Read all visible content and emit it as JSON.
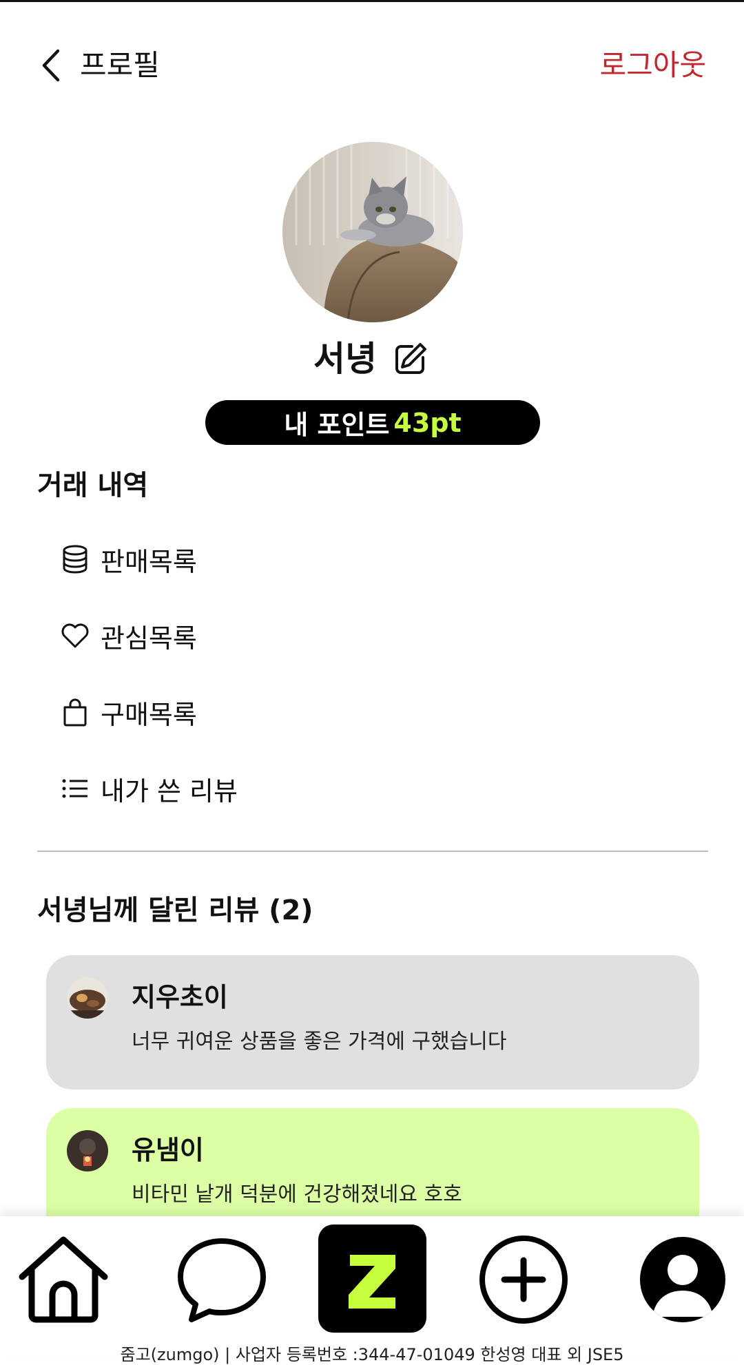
{
  "header": {
    "title": "프로필",
    "logout_label": "로그아웃"
  },
  "profile": {
    "name": "서녕",
    "points_label": "내 포인트",
    "points_value": "43pt"
  },
  "trade_history": {
    "title": "거래 내역",
    "items": [
      {
        "label": "판매목록",
        "icon": "coins-stack-icon"
      },
      {
        "label": "관심목록",
        "icon": "heart-icon"
      },
      {
        "label": "구매목록",
        "icon": "shopping-bag-icon"
      },
      {
        "label": "내가 쓴 리뷰",
        "icon": "list-icon"
      }
    ]
  },
  "reviews": {
    "title": "서녕님께 달린 리뷰 (2)",
    "items": [
      {
        "name": "지우초이",
        "text": "너무 귀여운 상품을 좋은 가격에 구했습니다",
        "bg": "#e0e0e0"
      },
      {
        "name": "유냄이",
        "text": "비타민 낱개 덕분에 건강해졌네요 호호",
        "bg": "#dcffa6"
      }
    ]
  },
  "bottom_nav": {
    "items": [
      "home-icon",
      "chat-bubble-icon",
      "zumgo-logo",
      "add-circle-icon",
      "profile-icon"
    ],
    "logo_letter": "Z",
    "logo_color": "#c6ff3d"
  },
  "footer": {
    "text": "줌고(zumgo) | 사업자 등록번호 :344-47-01049 한성영 대표 외 JSE5"
  },
  "colors": {
    "accent_red": "#c0282d",
    "accent_lime": "#c6ff3d"
  }
}
